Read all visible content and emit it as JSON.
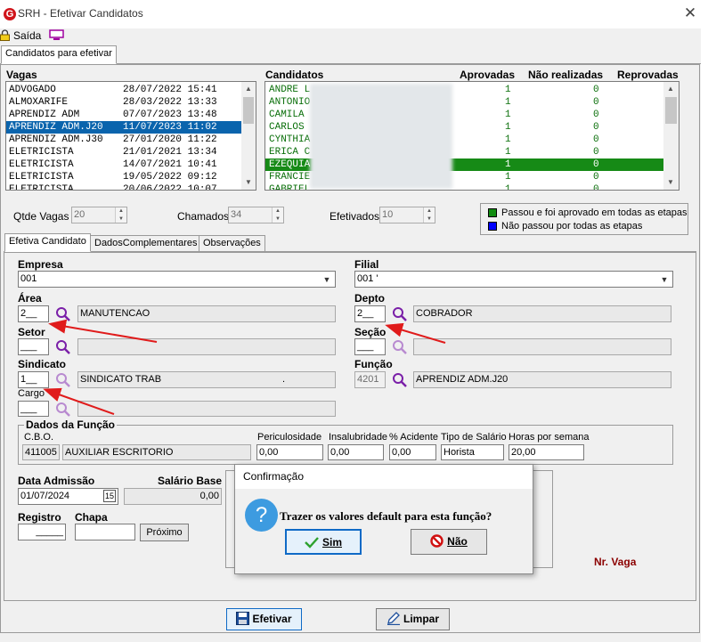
{
  "window": {
    "title": "SRH - Efetivar Candidatos",
    "close": "✕",
    "logo": "G"
  },
  "toolbar": {
    "exit_label": "Saída"
  },
  "main_tab": "Candidatos para efetivar",
  "vagas": {
    "header": "Vagas",
    "rows": [
      {
        "name": "ADVOGADO",
        "date": "28/07/2022 15:41"
      },
      {
        "name": "ALMOXARIFE",
        "date": "28/03/2022 13:33"
      },
      {
        "name": "APRENDIZ ADM",
        "date": "07/07/2023 13:48"
      },
      {
        "name": "APRENDIZ ADM.J20",
        "date": "11/07/2023 11:02"
      },
      {
        "name": "APRENDIZ ADM.J30",
        "date": "27/01/2020 11:22"
      },
      {
        "name": "ELETRICISTA",
        "date": "21/01/2021 13:34"
      },
      {
        "name": "ELETRICISTA",
        "date": "14/07/2021 10:41"
      },
      {
        "name": "ELETRICISTA",
        "date": "19/05/2022 09:12"
      },
      {
        "name": "ELETRICISTA",
        "date": "20/06/2022 10:07"
      }
    ],
    "selected_index": 3
  },
  "candidatos": {
    "headers": {
      "name": "Candidatos",
      "aprovadas": "Aprovadas",
      "nao_realizadas": "Não realizadas",
      "reprovadas": "Reprovadas"
    },
    "rows": [
      {
        "name": "ANDRE L",
        "aprovadas": "1",
        "nao_realizadas": "0"
      },
      {
        "name": "ANTONIO",
        "aprovadas": "1",
        "nao_realizadas": "0"
      },
      {
        "name": "CAMILA",
        "aprovadas": "1",
        "nao_realizadas": "0"
      },
      {
        "name": "CARLOS",
        "aprovadas": "1",
        "nao_realizadas": "0"
      },
      {
        "name": "CYNTHIA",
        "aprovadas": "1",
        "nao_realizadas": "0"
      },
      {
        "name": "ERICA C",
        "aprovadas": "1",
        "nao_realizadas": "0"
      },
      {
        "name": "EZEQUIA",
        "aprovadas": "1",
        "nao_realizadas": "0"
      },
      {
        "name": "FRANCIE",
        "aprovadas": "1",
        "nao_realizadas": "0"
      },
      {
        "name": "GABRIEL",
        "aprovadas": "1",
        "nao_realizadas": "0"
      }
    ],
    "selected_index": 6
  },
  "counts": {
    "qtde_vagas_label": "Qtde Vagas",
    "qtde_vagas": "20",
    "chamados_label": "Chamados",
    "chamados": "34",
    "efetivados_label": "Efetivados",
    "efetivados": "10"
  },
  "legend": {
    "green_label": "Passou e foi aprovado em todas as etapas",
    "blue_label": "Não passou por todas as etapas",
    "green_color": "#118c11",
    "blue_color": "#0000ff"
  },
  "subtabs": [
    "Efetiva Candidato",
    "DadosComplementares",
    "Observações"
  ],
  "form": {
    "empresa_label": "Empresa",
    "empresa_value": "001",
    "filial_label": "Filial",
    "filial_value": "001 '",
    "area_label": "Área",
    "area_code": "2__",
    "area_desc": "MANUTENCAO",
    "depto_label": "Depto",
    "depto_code": "2__",
    "depto_desc": "COBRADOR",
    "setor_label": "Setor",
    "setor_code": "___",
    "secao_label": "Seção",
    "secao_code": "___",
    "sindicato_label": "Sindicato",
    "sindicato_code": "1__",
    "sindicato_desc": "SINDICATO TRAB",
    "sindicato_dot": ".",
    "funcao_label": "Função",
    "funcao_code": "4201",
    "funcao_desc": "APRENDIZ ADM.J20",
    "cargo_label": "Cargo",
    "cargo_code": "___"
  },
  "dados_funcao": {
    "header": "Dados da Função",
    "cbo_label": "C.B.O.",
    "cbo_code": "411005",
    "cbo_desc": "AUXILIAR ESCRITORIO",
    "periculosidade_label": "Periculosidade",
    "periculosidade": "0,00",
    "insalubridade_label": "Insalubridade",
    "insalubridade": "0,00",
    "acidente_label": "% Acidente",
    "acidente": "0,00",
    "tipo_salario_label": "Tipo de Salário",
    "tipo_salario": "Horista",
    "horas_label": "Horas por semana",
    "horas": "20,00"
  },
  "admissao": {
    "data_label": "Data Admissão",
    "data_value": "01/07/2024",
    "cal_label": "15",
    "salario_label": "Salário Base",
    "salario_value": "0,00",
    "registro_label": "Registro",
    "registro_value": "_____",
    "chapa_label": "Chapa",
    "proximo_label": "Próximo"
  },
  "nr_vaga_label": "Nr. Vaga",
  "dialog": {
    "title": "Confirmação",
    "message": "Trazer os valores default para esta função?",
    "question_glyph": "?",
    "yes_label": "Sim",
    "no_label": "Não"
  },
  "footer": {
    "efetivar_label": "Efetivar",
    "limpar_label": "Limpar"
  }
}
